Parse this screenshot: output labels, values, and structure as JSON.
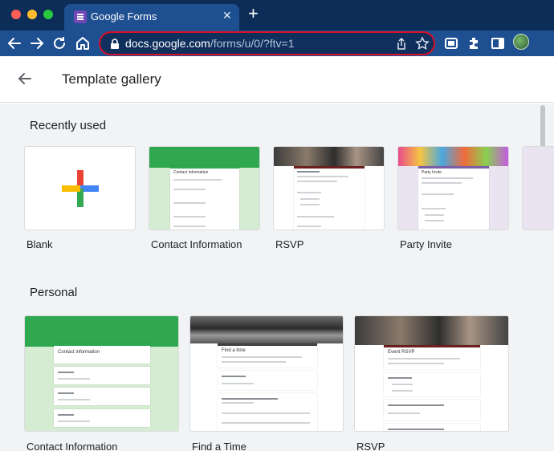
{
  "browser": {
    "tab_title": "Google Forms",
    "url_host": "docs.google.com",
    "url_path": "/forms/u/0/?ftv=1"
  },
  "header": {
    "title": "Template gallery"
  },
  "sections": {
    "recent": {
      "title": "Recently used",
      "items": [
        "Blank",
        "Contact Information",
        "RSVP",
        "Party Invite"
      ]
    },
    "personal": {
      "title": "Personal",
      "items": [
        "Contact Information",
        "Find a Time",
        "RSVP"
      ]
    }
  },
  "thumbnails": {
    "contact_title": "Contact information",
    "rsvp_title": "Event RSVP",
    "party_title": "Party Invite",
    "find_title": "Find a time"
  },
  "colors": {
    "chrome_dark": "#0c2d57",
    "chrome_light": "#1e4f91",
    "highlight": "#d9102a",
    "forms_green": "#2fa84f",
    "forms_purple": "#7248b9"
  },
  "icons": [
    "back-icon",
    "forward-icon",
    "reload-icon",
    "home-icon",
    "lock-icon",
    "share-icon",
    "star-icon",
    "tab-search-icon",
    "extensions-icon",
    "side-panel-icon",
    "back-arrow-icon",
    "plus-icon"
  ]
}
